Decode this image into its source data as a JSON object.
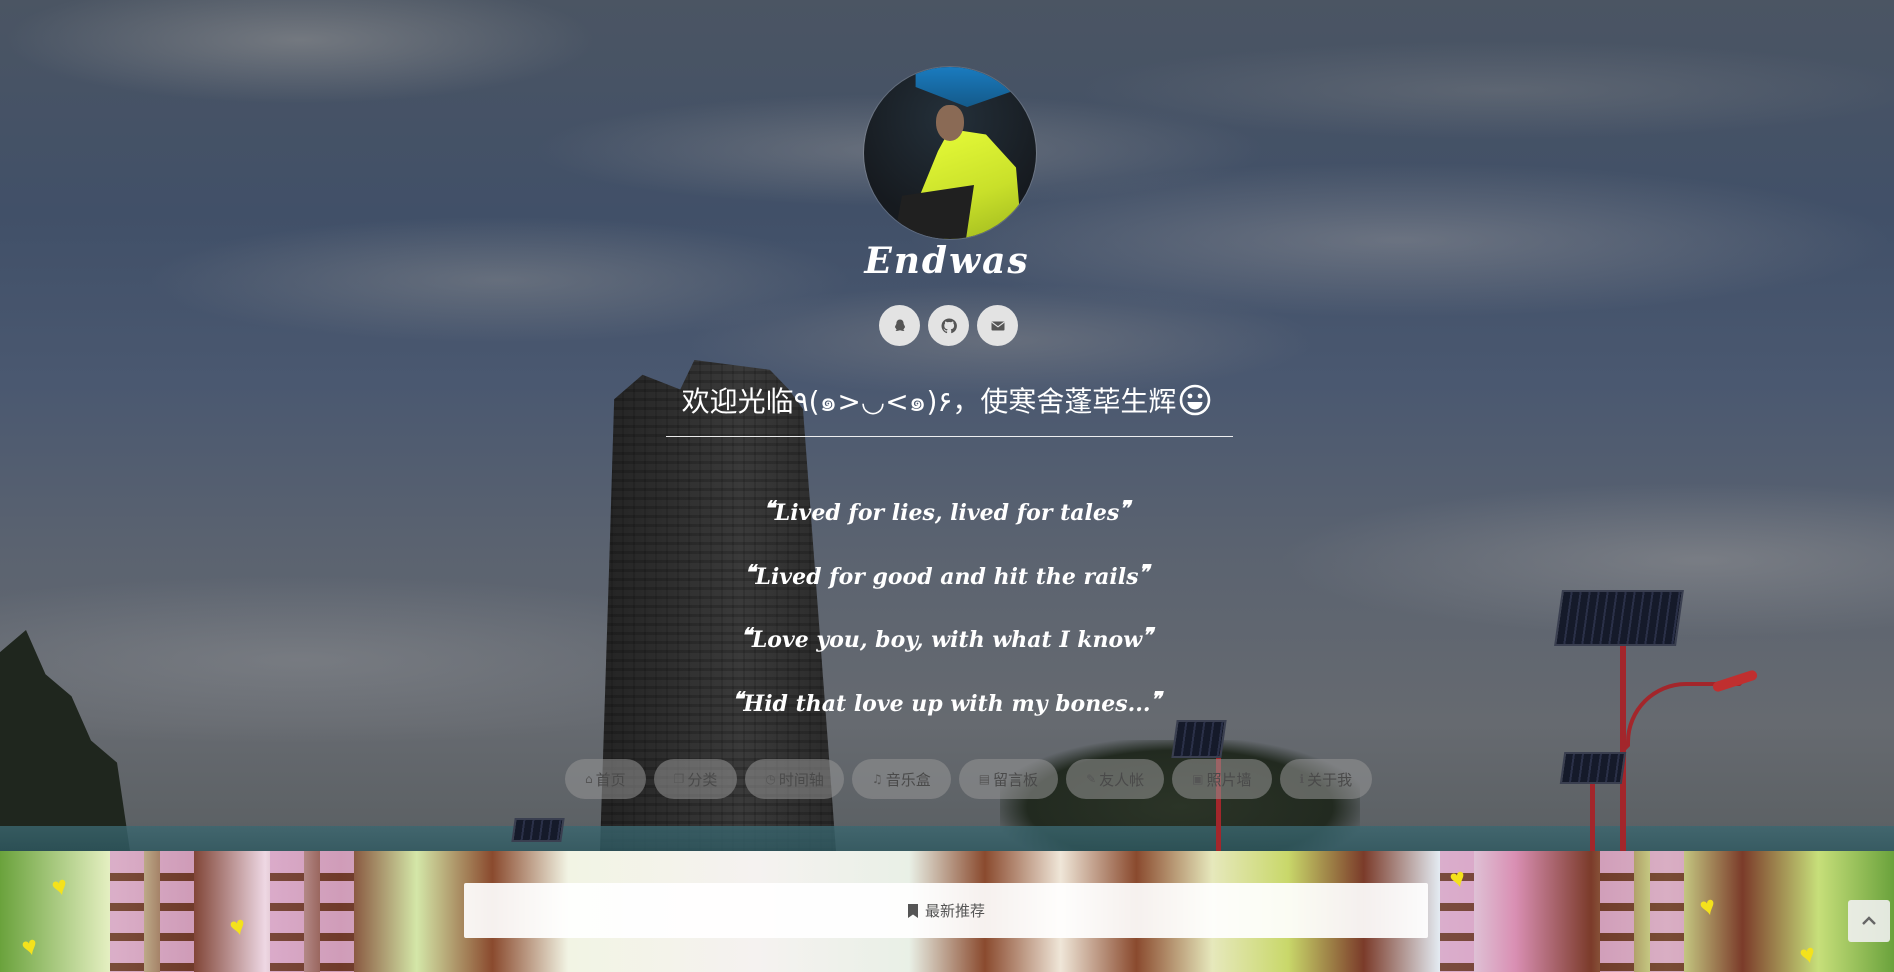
{
  "site": {
    "name": "Endwas",
    "welcome": "欢迎光临٩(๑>◡<๑)۶，使寒舍蓬荜生辉"
  },
  "socials": [
    {
      "name": "qq",
      "icon": "qq-penguin-icon"
    },
    {
      "name": "github",
      "icon": "github-icon"
    },
    {
      "name": "email",
      "icon": "envelope-icon"
    }
  ],
  "lyrics": [
    "Lived for lies, lived for tales",
    "Lived for good and hit the rails",
    "Love you, boy, with what I know",
    "Hid that love up with my bones..."
  ],
  "nav": [
    {
      "icon": "home-icon",
      "glyph": "⌂",
      "label": "首页"
    },
    {
      "icon": "copy-icon",
      "glyph": "❐",
      "label": "分类"
    },
    {
      "icon": "clock-icon",
      "glyph": "◷",
      "label": "时间轴"
    },
    {
      "icon": "music-icon",
      "glyph": "♫",
      "label": "音乐盒"
    },
    {
      "icon": "book-icon",
      "glyph": "▤",
      "label": "留言板"
    },
    {
      "icon": "pencil-icon",
      "glyph": "✎",
      "label": "友人帐"
    },
    {
      "icon": "image-icon",
      "glyph": "▣",
      "label": "照片墙"
    },
    {
      "icon": "info-icon",
      "glyph": "ℹ",
      "label": "关于我"
    }
  ],
  "featured": {
    "icon": "bookmark-icon",
    "label": "最新推荐"
  },
  "back_to_top": {
    "icon": "chevron-up-icon"
  }
}
